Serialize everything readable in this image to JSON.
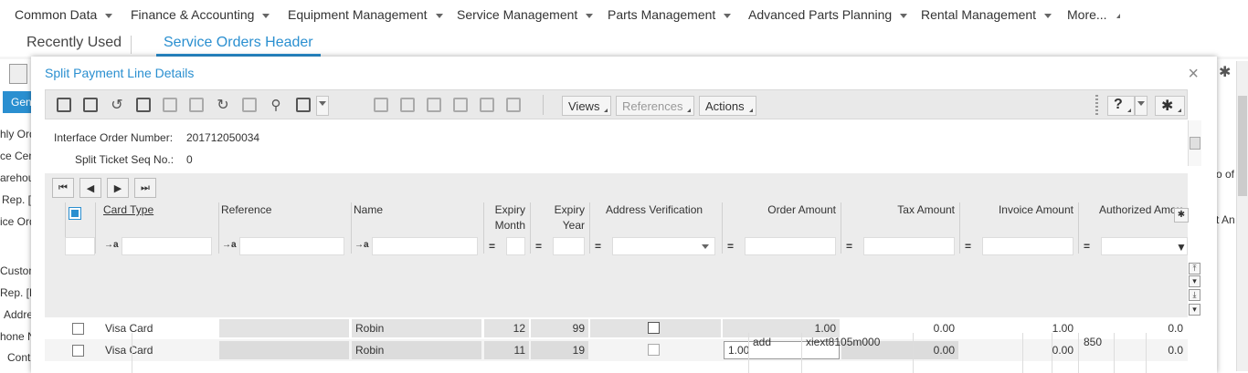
{
  "topnav": {
    "items": [
      "Common Data",
      "Finance & Accounting",
      "Equipment Management",
      "Service Management",
      "Parts Management",
      "Advanced Parts Planning",
      "Rental Management"
    ],
    "more": "More..."
  },
  "tabs": {
    "recent": "Recently Used",
    "active": "Service Orders Header"
  },
  "background": {
    "left_fragments": [
      "Gen",
      "hly Ord",
      "ce Cent",
      "arehou",
      "Rep. [",
      "ice Ord",
      "Custom",
      "Rep. [E",
      "Addre",
      "hone N",
      "Cont"
    ],
    "right_fragments": [
      "o of",
      "t An"
    ],
    "bottom_row": {
      "col1": "add",
      "col2": "xiext8105m000",
      "col3": "850"
    }
  },
  "modal": {
    "title": "Split Payment Line Details",
    "close": "×",
    "toolbar": {
      "views": "Views",
      "references": "References",
      "actions": "Actions",
      "help": "?"
    },
    "form": {
      "interface_order_label": "Interface Order Number:",
      "interface_order_value": "201712050034",
      "split_seq_label": "Split Ticket Seq No.:",
      "split_seq_value": "0"
    },
    "grid": {
      "headers": {
        "card_type": "Card Type",
        "reference": "Reference",
        "name": "Name",
        "expiry_month_1": "Expiry",
        "expiry_month_2": "Month",
        "expiry_year_1": "Expiry",
        "expiry_year_2": "Year",
        "address_verification": "Address Verification",
        "order_amount": "Order Amount",
        "tax_amount": "Tax Amount",
        "invoice_amount": "Invoice Amount",
        "authorized_amount": "Authorized Amour"
      },
      "filter_prefix_text": "→a",
      "filter_prefix_num": "=",
      "rows": [
        {
          "card_type": "Visa Card",
          "reference": "",
          "name": "Robin",
          "expiry_month": "12",
          "expiry_year": "99",
          "order_amount": "1.00",
          "tax_amount": "0.00",
          "invoice_amount": "1.00",
          "authorized_amount": "0.0"
        },
        {
          "card_type": "Visa Card",
          "reference": "",
          "name": "Robin",
          "expiry_month": "11",
          "expiry_year": "19",
          "order_amount": "1.00",
          "tax_amount": "0.00",
          "invoice_amount": "0.00",
          "authorized_amount": "0.0"
        }
      ]
    }
  }
}
